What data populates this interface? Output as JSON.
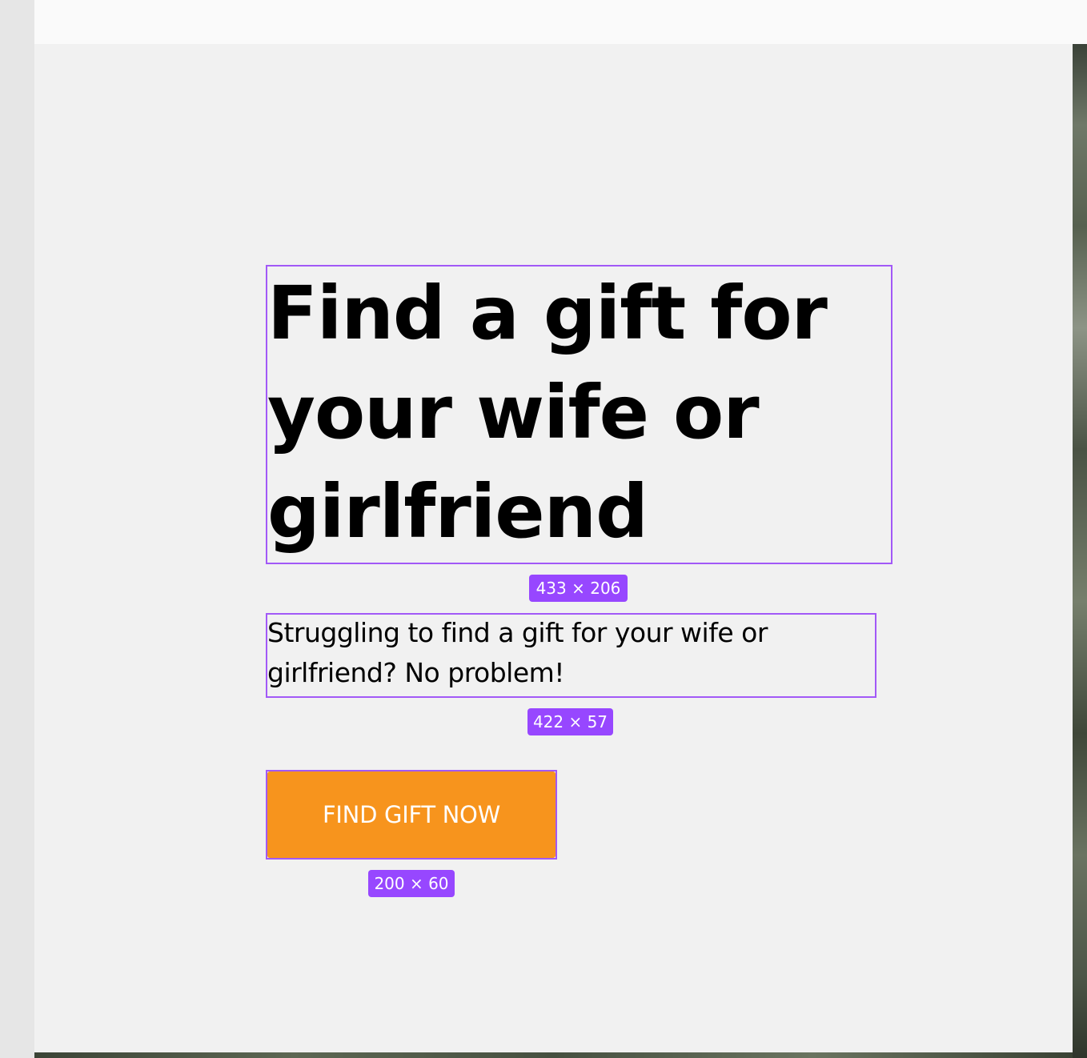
{
  "hero": {
    "headline": "Find a gift for your wife or girlfriend",
    "subtext": "Struggling to find a gift for your wife or girlfriend?  No problem!",
    "cta_label": "FIND GIFT NOW",
    "cta_color": "#f7941d"
  },
  "selection_overlay": {
    "accent_color": "#9747ff",
    "headline_badge": "433 × 206",
    "subtext_badge": "422 × 57",
    "button_badge": "200 × 60"
  }
}
